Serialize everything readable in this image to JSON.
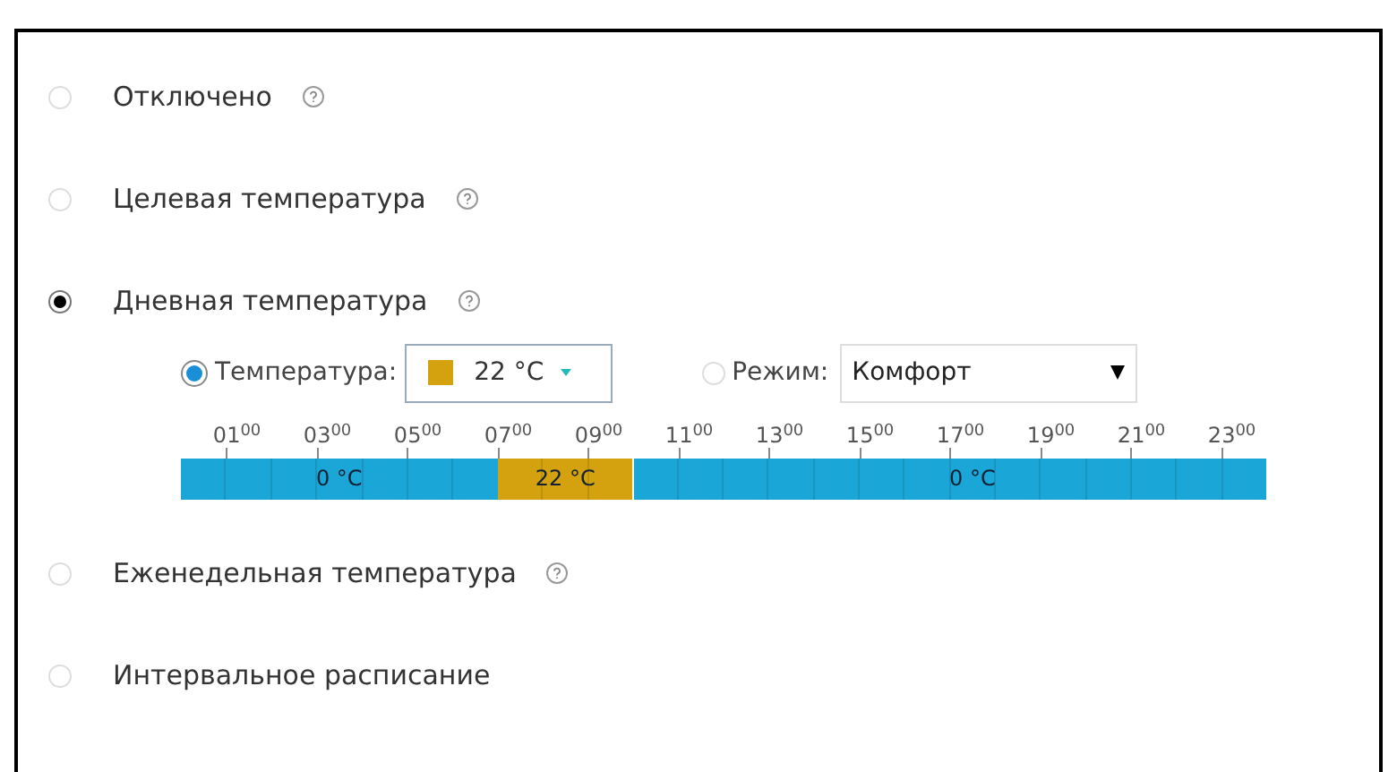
{
  "modes": [
    {
      "label": "Отключено",
      "selected": false,
      "help": true
    },
    {
      "label": "Целевая температура",
      "selected": false,
      "help": true
    },
    {
      "label": "Дневная температура",
      "selected": true,
      "help": true,
      "panel": {
        "temperature": {
          "label": "Температура:",
          "selected": true,
          "value": "22 °C",
          "color": "#d4a20f"
        },
        "mode": {
          "label": "Режим:",
          "selected": false,
          "value": "Комфорт"
        },
        "hours": [
          "01$^{00}$",
          "03$^{00}$",
          "05$^{00}$",
          "07$^{00}$",
          "09$^{00}$",
          "11$^{00}$",
          "13$^{00}$",
          "15$^{00}$",
          "17$^{00}$",
          "19$^{00}$",
          "21$^{00}$",
          "23$^{00}$"
        ],
        "hour_cells": [
          {
            "color": "#1aa6d6"
          },
          {
            "color": "#1aa6d6"
          },
          {
            "color": "#1aa6d6"
          },
          {
            "color": "#1aa6d6"
          },
          {
            "color": "#1aa6d6"
          },
          {
            "color": "#1aa6d6"
          },
          {
            "color": "#1aa6d6"
          },
          {
            "color": "#d4a20f"
          },
          {
            "color": "#d4a20f"
          },
          {
            "color": "#d4a20f"
          },
          {
            "color": "#1aa6d6"
          },
          {
            "color": "#1aa6d6"
          },
          {
            "color": "#1aa6d6"
          },
          {
            "color": "#1aa6d6"
          },
          {
            "color": "#1aa6d6"
          },
          {
            "color": "#1aa6d6"
          },
          {
            "color": "#1aa6d6"
          },
          {
            "color": "#1aa6d6"
          },
          {
            "color": "#1aa6d6"
          },
          {
            "color": "#1aa6d6"
          },
          {
            "color": "#1aa6d6"
          },
          {
            "color": "#1aa6d6"
          },
          {
            "color": "#1aa6d6"
          },
          {
            "color": "#1aa6d6"
          }
        ],
        "segment_labels": [
          "0 °C",
          "22 °C",
          "0 °C"
        ]
      }
    },
    {
      "label": "Еженедельная температура",
      "selected": false,
      "help": true
    },
    {
      "label": "Интервальное расписание",
      "selected": false,
      "help": false
    }
  ]
}
